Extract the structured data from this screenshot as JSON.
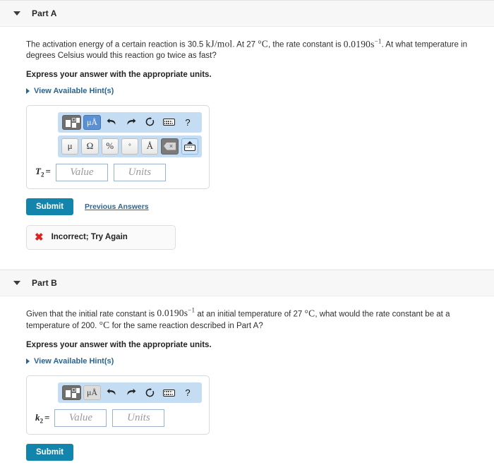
{
  "parts": [
    {
      "id": "part-a",
      "title": "Part A",
      "caret": "caret-down-icon",
      "question": {
        "seg1": "The activation energy of a certain reaction is 30.5 ",
        "math1": "kJ/mol",
        "seg2": ". At 27 ",
        "math2": "°C",
        "seg3": ", the rate constant is ",
        "math3": "0.0190s",
        "math3_sup": "−1",
        "seg4": ". At what temperature in degrees Celsius would this reaction go twice as fast?"
      },
      "instruction": "Express your answer with the appropriate units.",
      "hint_label": "View Available Hint(s)",
      "toolbar": {
        "template_icon": "template-grid-icon",
        "mua_label": "μÅ",
        "mua_active": true,
        "undo_icon": "undo-arrow-icon",
        "redo_icon": "redo-arrow-icon",
        "reset_icon": "reset-circular-arrow-icon",
        "keyboard_icon": "keyboard-icon",
        "help_label": "?"
      },
      "symbol_row": {
        "present": true,
        "buttons": [
          "μ",
          "Ω",
          "%",
          "°",
          "Å"
        ],
        "backspace_icon": "backspace-icon",
        "keyboard_up_icon": "keyboard-up-icon"
      },
      "answer": {
        "variable": "T",
        "subscript": "2",
        "equals": "=",
        "value_placeholder": "Value",
        "units_placeholder": "Units"
      },
      "submit_label": "Submit",
      "previous_answers_label": "Previous Answers",
      "feedback": {
        "present": true,
        "icon": "x-mark-icon",
        "text": "Incorrect; Try Again"
      }
    },
    {
      "id": "part-b",
      "title": "Part B",
      "caret": "caret-down-icon",
      "question": {
        "seg1": "Given that the initial rate constant is ",
        "math1": "0.0190s",
        "math1_sup": "−1",
        "seg2": " at an initial temperature of 27 ",
        "math2": "°C",
        "seg3": ", what would the rate constant be at a temperature of 200. ",
        "math3": "°C",
        "seg4": " for the same reaction described in Part A?"
      },
      "instruction": "Express your answer with the appropriate units.",
      "hint_label": "View Available Hint(s)",
      "toolbar": {
        "template_icon": "template-grid-icon",
        "mua_label": "μÅ",
        "mua_active": false,
        "undo_icon": "undo-arrow-icon",
        "redo_icon": "redo-arrow-icon",
        "reset_icon": "reset-circular-arrow-icon",
        "keyboard_icon": "keyboard-icon",
        "help_label": "?"
      },
      "symbol_row": {
        "present": false
      },
      "answer": {
        "variable": "k",
        "subscript": "2",
        "equals": "=",
        "value_placeholder": "Value",
        "units_placeholder": "Units"
      },
      "submit_label": "Submit",
      "previous_answers_label": "",
      "feedback": {
        "present": false
      }
    }
  ],
  "colors": {
    "accent_submit": "#1384ab",
    "link": "#2a6496",
    "toolbar_bg": "#c5ddf2",
    "header_bg": "#f7f7f7",
    "error": "#d9241f",
    "mua_active": "#5b91d4"
  }
}
